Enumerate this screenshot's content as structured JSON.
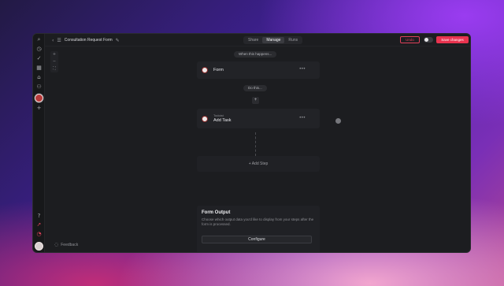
{
  "header": {
    "title": "Consultation Request Form",
    "tabs": [
      {
        "label": "Share",
        "active": false
      },
      {
        "label": "Manage",
        "active": true
      },
      {
        "label": "Runs",
        "active": false
      }
    ],
    "undo_label": "Undo",
    "save_label": "Save changes"
  },
  "canvas": {
    "trigger_pill": "When this happens...",
    "action_pill": "Do this...",
    "plus": "+",
    "form_card": {
      "title": "Form",
      "menu": "•••"
    },
    "task_card": {
      "app": "Todoist",
      "title": "Add Task",
      "menu": "•••"
    },
    "add_step_label": "+ Add Step",
    "zoom": {
      "in": "+",
      "out": "−",
      "fit": "⛶"
    }
  },
  "output": {
    "title": "Form Output",
    "description": "Choose which output data you'd like to display from your steps after the form is processed.",
    "button_label": "Configure"
  },
  "footer": {
    "feedback_label": "Feedback"
  },
  "colors": {
    "accent": "#e8334f",
    "window_bg": "#1c1d20",
    "card_bg": "#222327"
  },
  "icons": [
    "search-icon",
    "clock-icon",
    "check-circle-icon",
    "calendar-icon",
    "home-icon",
    "users-icon",
    "plus-icon",
    "help-icon",
    "rocket-icon",
    "bell-icon",
    "chevron-left-icon",
    "settings-icon",
    "edit-icon"
  ]
}
